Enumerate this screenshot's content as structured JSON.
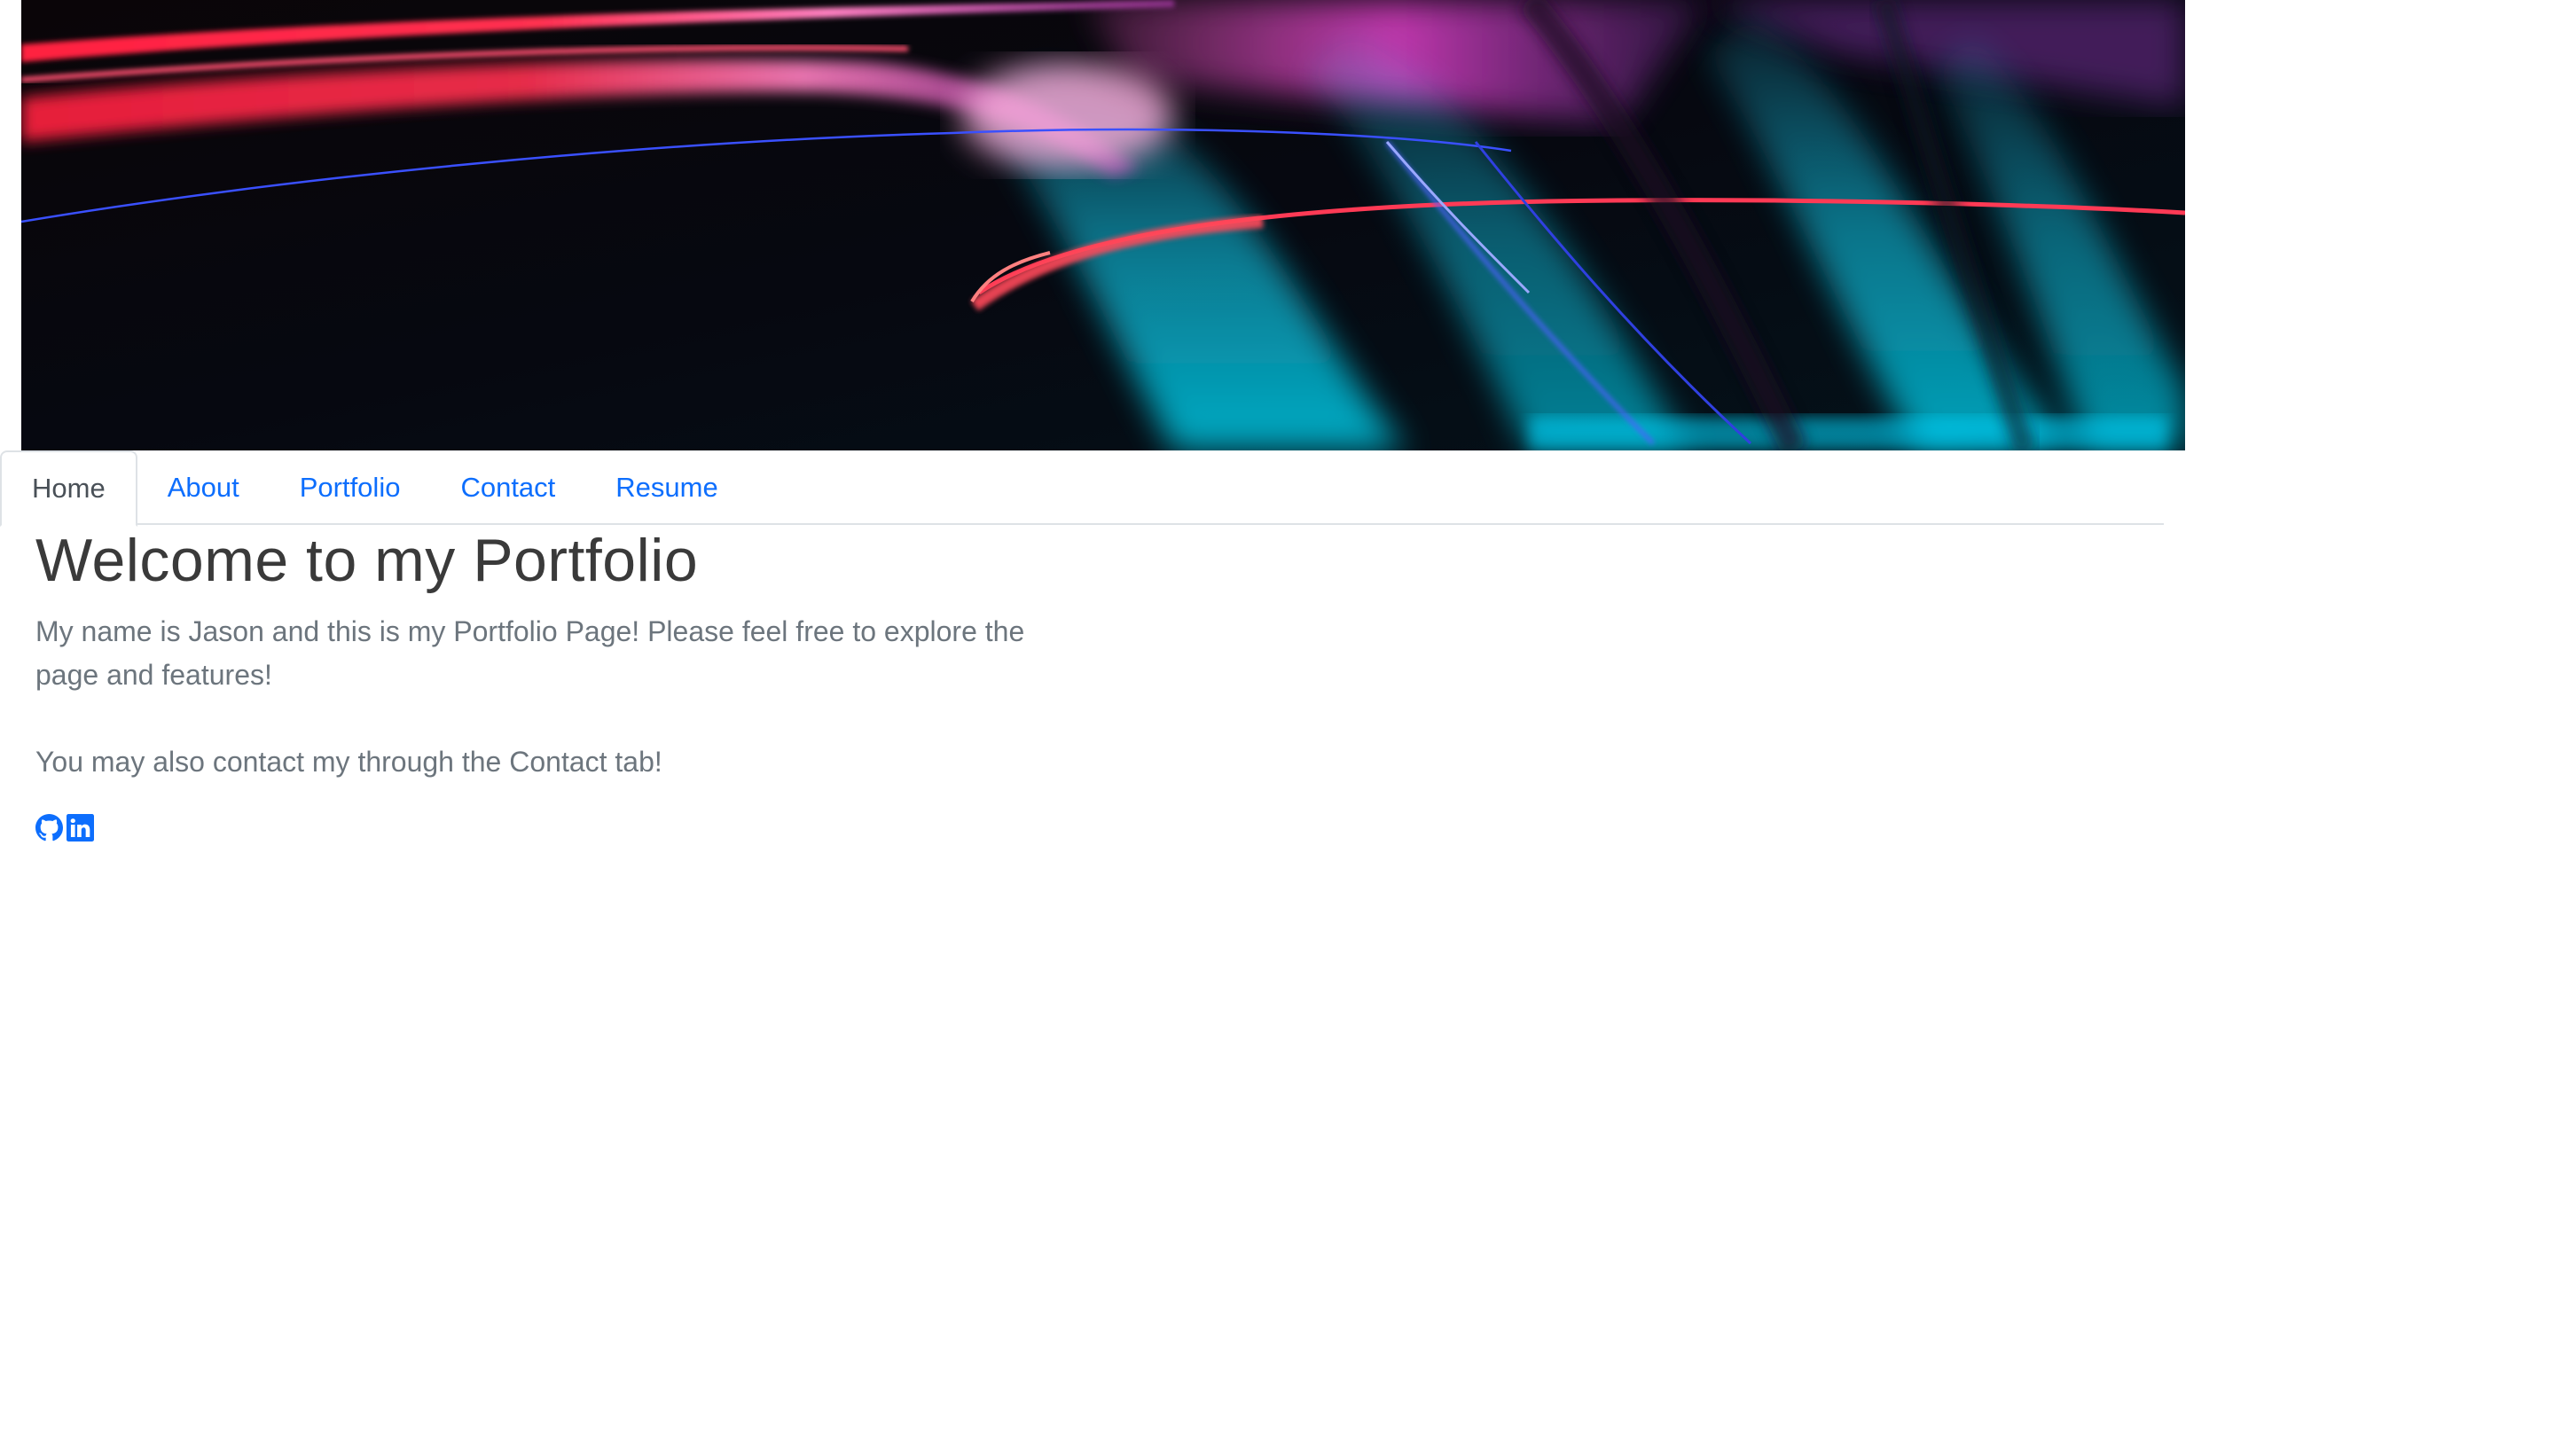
{
  "hero": {
    "description_icon": "light-trails-banner"
  },
  "tabs": [
    {
      "label": "Home",
      "active": true
    },
    {
      "label": "About",
      "active": false
    },
    {
      "label": "Portfolio",
      "active": false
    },
    {
      "label": "Contact",
      "active": false
    },
    {
      "label": "Resume",
      "active": false
    }
  ],
  "main": {
    "title": "Welcome to my Portfolio",
    "intro": "My name is Jason and this is my Portfolio Page! Please feel free to explore the page and features!",
    "contact_note": "You may also contact my through the Contact tab!"
  },
  "socials": [
    {
      "icon": "github-icon"
    },
    {
      "icon": "linkedin-icon"
    }
  ],
  "colors": {
    "link": "#0d6efd",
    "active_tab_text": "#495057",
    "muted_text": "#6c757d",
    "border": "#dee2e6"
  }
}
